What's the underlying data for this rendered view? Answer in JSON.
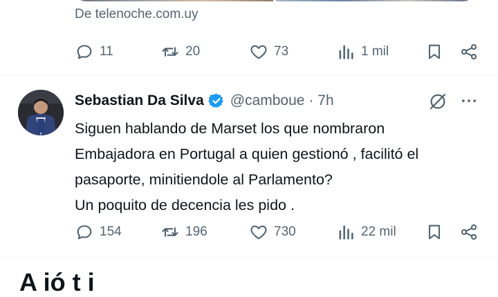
{
  "prev_tweet": {
    "source_link": "De telenoche.com.uy",
    "actions": {
      "replies": "11",
      "retweets": "20",
      "likes": "73",
      "views": "1 mil"
    }
  },
  "tweet": {
    "author_name": "Sebastian Da Silva",
    "handle": "@camboue",
    "time": "· 7h",
    "text_lines": [
      "Siguen hablando de Marset los que nombraron",
      "Embajadora en Portugal a quien gestionó , facilitó el",
      "pasaporte, minitiendole al Parlamento?",
      "Un poquito de decencia les pido ."
    ],
    "actions": {
      "replies": "154",
      "retweets": "196",
      "likes": "730",
      "views": "22 mil"
    }
  },
  "next_section": {
    "heading_partial": "A   ió   t i"
  },
  "colors": {
    "text": "#0f1419",
    "muted": "#536471",
    "verified": "#1d9bf0",
    "divider": "#eff3f4"
  }
}
